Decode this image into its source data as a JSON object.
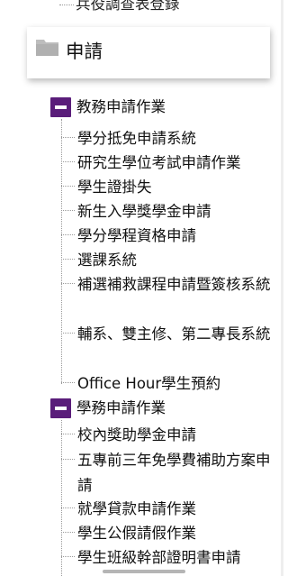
{
  "previous_item": {
    "label": "兵役調查表登錄"
  },
  "section": {
    "title": "申請",
    "icon": "folder-icon"
  },
  "groups": [
    {
      "label": "教務申請作業",
      "icon": "minus-icon",
      "items": [
        {
          "label": "學分抵免申請系統"
        },
        {
          "label": "研究生學位考試申請作業"
        },
        {
          "label": "學生證掛失"
        },
        {
          "label": "新生入學獎學金申請"
        },
        {
          "label": "學分學程資格申請"
        },
        {
          "label": "選課系統"
        },
        {
          "label": "補選補救課程申請暨簽核系統"
        },
        {
          "label": "輔系、雙主修、第二專長系統"
        },
        {
          "label": "Office Hour學生預約"
        }
      ]
    },
    {
      "label": "學務申請作業",
      "icon": "minus-icon",
      "items": [
        {
          "label": "校內獎助學金申請"
        },
        {
          "label": "五專前三年免學費補助方案申請"
        },
        {
          "label": "就學貸款申請作業"
        },
        {
          "label": "學生公假請假作業"
        },
        {
          "label": "學生班級幹部證明書申請"
        }
      ]
    }
  ],
  "colors": {
    "toggle_icon": "#5a1d7a",
    "tree_line": "#9a9a9a",
    "text": "#111111"
  }
}
